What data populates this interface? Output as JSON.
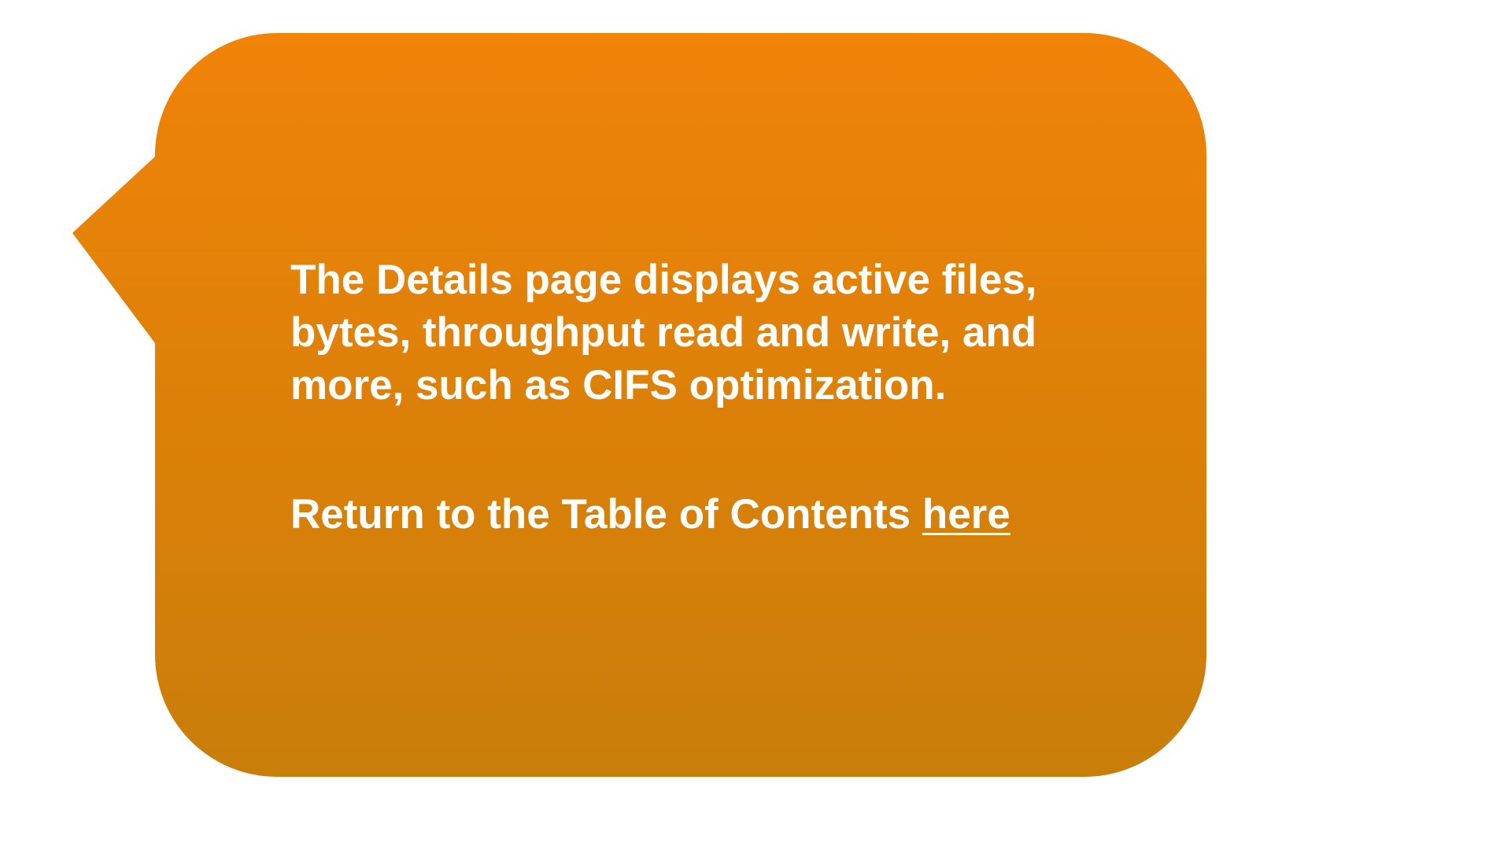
{
  "callout": {
    "fill_top": "#F08308",
    "fill_bottom": "#C97E0A",
    "text_color": "#FFFFFF",
    "paragraph": "The Details page displays active files, bytes, throughput read and write, and more, such as CIFS optimization.",
    "toc_prefix": "Return to the Table of Contents ",
    "toc_link": "here"
  }
}
